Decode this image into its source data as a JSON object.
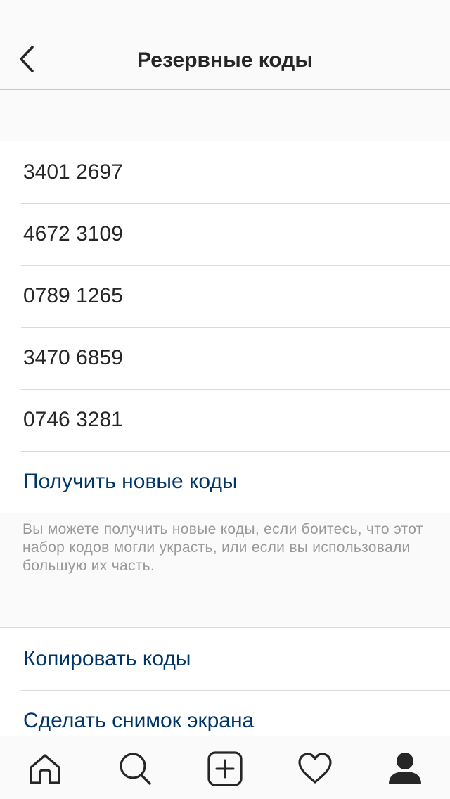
{
  "header": {
    "title": "Резервные коды",
    "back_icon": "chevron-left-icon"
  },
  "codes": [
    "3401 2697",
    "4672 3109",
    "0789 1265",
    "3470 6859",
    "0746 3281"
  ],
  "get_new_codes_label": "Получить новые коды",
  "footnote": "Вы можете получить новые коды, если боитесь, что этот набор кодов могли украсть, или если вы использовали большую их часть.",
  "actions": {
    "copy_label": "Копировать коды",
    "screenshot_label": "Сделать снимок экрана"
  },
  "tabbar": {
    "items": [
      {
        "icon": "home-icon"
      },
      {
        "icon": "search-icon"
      },
      {
        "icon": "add-post-icon"
      },
      {
        "icon": "heart-icon"
      },
      {
        "icon": "profile-icon",
        "active": true
      }
    ]
  },
  "colors": {
    "link": "#003569",
    "text": "#262626",
    "secondary_text": "#999999",
    "background": "#fafafa"
  }
}
